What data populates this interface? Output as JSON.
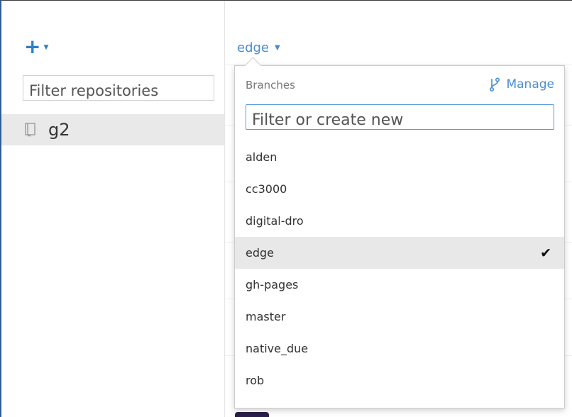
{
  "sidebar": {
    "add_icon": "plus-icon",
    "filter_placeholder": "Filter repositories",
    "repositories": [
      {
        "name": "g2",
        "icon": "repo-book-icon"
      }
    ]
  },
  "main": {
    "current_branch": "edge"
  },
  "branch_dropdown": {
    "header": "Branches",
    "manage_label": "Manage",
    "filter_placeholder": "Filter or create new",
    "branches": [
      "alden",
      "cc3000",
      "digital-dro",
      "edge",
      "gh-pages",
      "master",
      "native_due",
      "rob"
    ],
    "selected": "edge"
  },
  "colors": {
    "accent": "#4a8dcf",
    "add_blue": "#2d7cc7",
    "selected_row": "#e8e8e8",
    "sidebar_selected": "#e9e9e9"
  }
}
